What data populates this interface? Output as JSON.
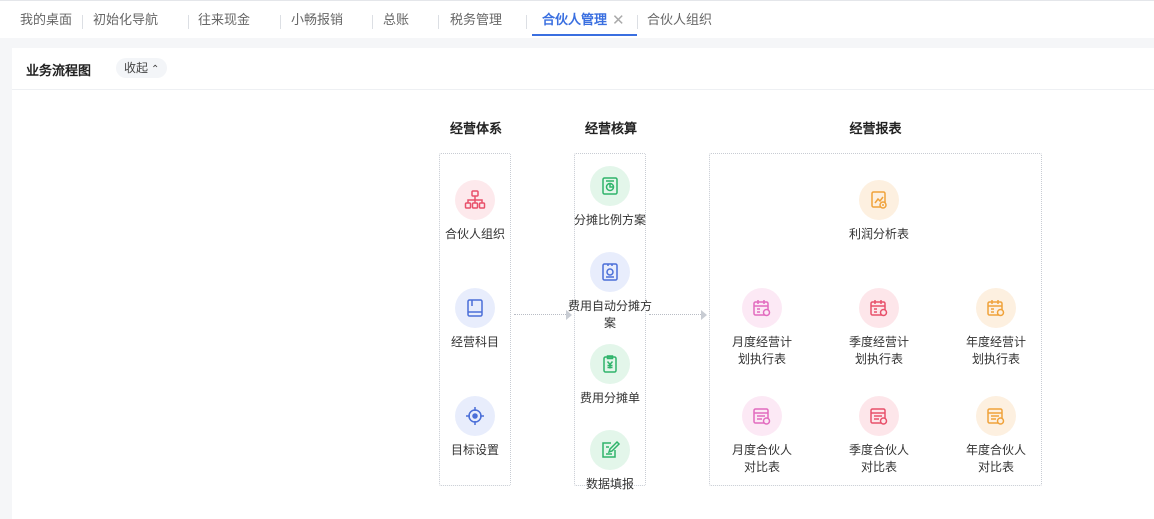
{
  "tabs": [
    {
      "label": "我的桌面"
    },
    {
      "label": "初始化导航"
    },
    {
      "label": "往来现金"
    },
    {
      "label": "小畅报销"
    },
    {
      "label": "总账"
    },
    {
      "label": "税务管理"
    },
    {
      "label": "合伙人管理",
      "active": true
    },
    {
      "label": "合伙人组织"
    }
  ],
  "header": {
    "title": "业务流程图",
    "collapse_label": "收起"
  },
  "flow": {
    "columns": [
      {
        "title": "经营体系",
        "items": [
          {
            "label": "合伙人组织",
            "icon": "org-chart-icon"
          },
          {
            "label": "经营科目",
            "icon": "book-icon"
          },
          {
            "label": "目标设置",
            "icon": "target-icon"
          }
        ]
      },
      {
        "title": "经营核算",
        "items": [
          {
            "label": "分摊比例方案",
            "icon": "pie-document-icon"
          },
          {
            "label": "费用自动分摊方案",
            "icon": "auto-allocation-icon"
          },
          {
            "label": "费用分摊单",
            "icon": "yuan-clipboard-icon"
          },
          {
            "label": "数据填报",
            "icon": "edit-document-icon"
          }
        ]
      },
      {
        "title": "经营报表",
        "items": [
          {
            "label": "利润分析表",
            "icon": "chart-report-icon"
          },
          {
            "label": "月度经营计划执行表",
            "icon": "calendar-report-icon"
          },
          {
            "label": "季度经营计划执行表",
            "icon": "calendar-report-icon"
          },
          {
            "label": "年度经营计划执行表",
            "icon": "calendar-report-icon"
          },
          {
            "label": "月度合伙人对比表",
            "icon": "table-report-icon"
          },
          {
            "label": "季度合伙人对比表",
            "icon": "table-report-icon"
          },
          {
            "label": "年度合伙人对比表",
            "icon": "table-report-icon"
          }
        ]
      }
    ]
  },
  "colors": {
    "accent": "#3a6fe0",
    "red": "#e8506a",
    "blue": "#4b6fd8",
    "green": "#2fb36b",
    "orange": "#f0a23a",
    "pink": "#e26bbf"
  }
}
